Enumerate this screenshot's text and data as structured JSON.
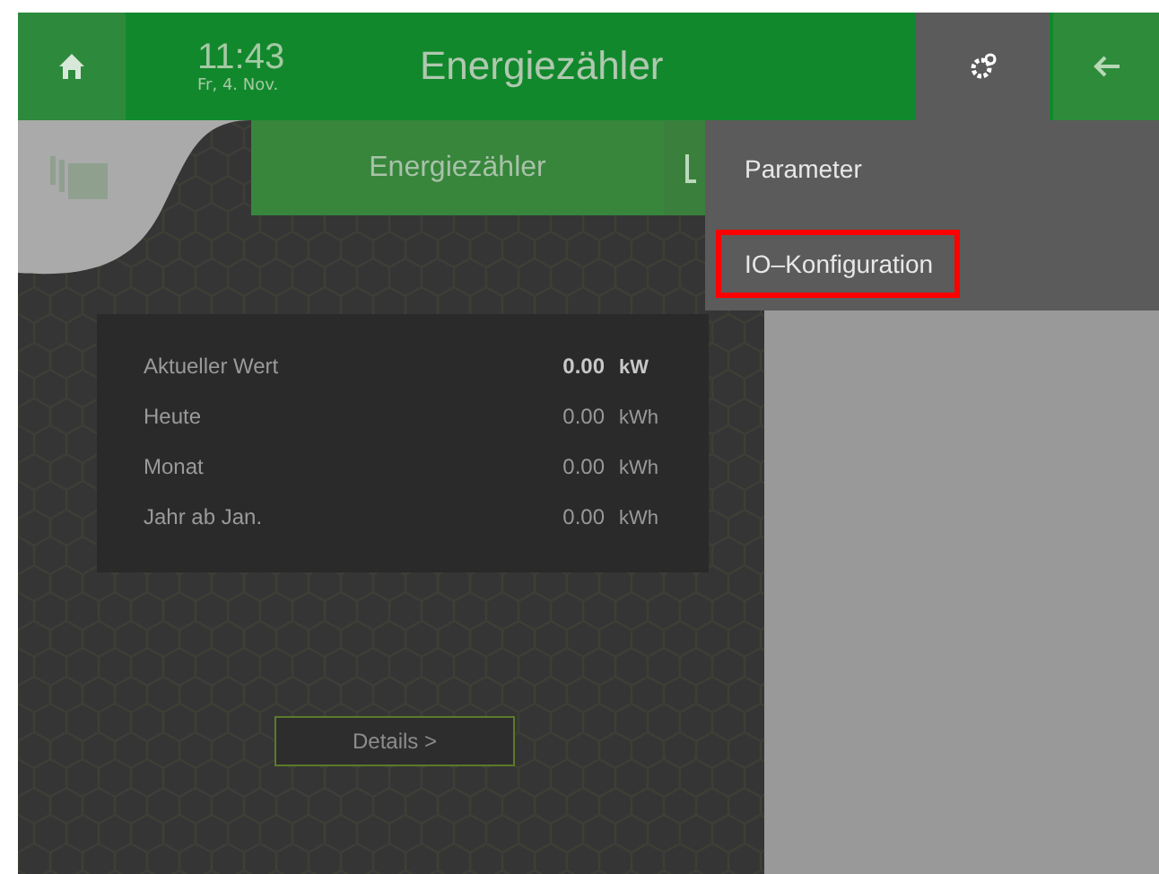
{
  "header": {
    "time": "11:43",
    "date": "Fr, 4. Nov.",
    "title": "Energiezähler",
    "settings_open": true
  },
  "tabs": [
    {
      "label": "Energiezähler",
      "selected": true
    }
  ],
  "menu": [
    {
      "label": "Parameter",
      "highlighted": false
    },
    {
      "label": "IO–Konfiguration",
      "highlighted": true
    }
  ],
  "readings": [
    {
      "label": "Aktueller Wert",
      "value": "0.00",
      "unit": "kW",
      "bold": true
    },
    {
      "label": "Heute",
      "value": "0.00",
      "unit": "kWh",
      "bold": false
    },
    {
      "label": "Monat",
      "value": "0.00",
      "unit": "kWh",
      "bold": false
    },
    {
      "label": "Jahr ab Jan.",
      "value": "0.00",
      "unit": "kWh",
      "bold": false
    }
  ],
  "details_button": "Details >"
}
